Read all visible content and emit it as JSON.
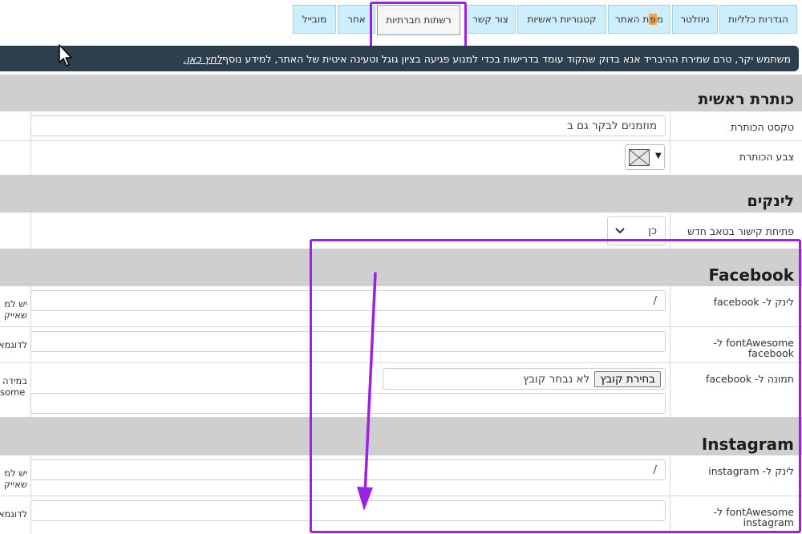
{
  "tabs": [
    {
      "label": "הגדרות כלליות"
    },
    {
      "label": "ניוזלטר"
    },
    {
      "label_prefix": "מ",
      "label_highlight": "פ",
      "label_suffix": "ת האתר"
    },
    {
      "label": "קטגוריות ראשיות"
    },
    {
      "label": "צור קשר"
    },
    {
      "label": "רשתות חברתיות"
    },
    {
      "label": "אחר"
    },
    {
      "label": "מובייל"
    }
  ],
  "notice": {
    "text": "משתמש יקר, טרם שמירת ההיבריד אנא בדוק שהקוד עומד בדרישות בכדי למנוע פגיעה בציון גוגל וטעינה איטית של האתר, למידע נוסף ",
    "link": "לחץ כאן."
  },
  "sections": {
    "main_title": "כותרת ראשית",
    "links": "לינקים",
    "facebook": "Facebook",
    "instagram": "Instagram"
  },
  "rows": {
    "title_text_label": "טקסט הכותרת",
    "title_text_value": "מוזמנים לבקר גם ב",
    "title_color_label": "צבע הכותרת",
    "new_tab_label": "פתיחת קישור בטאב חדש",
    "new_tab_value": "כן",
    "fb_link_label": "לינק ל- facebook",
    "fb_link_value": "/",
    "fb_fa_label_1": "fontAwesome ל-",
    "fb_fa_label_2": "facebook",
    "fb_img_label": "תמונה ל- facebook",
    "file_button": "בחירת קובץ",
    "file_none": "לא נבחר קובץ",
    "ig_link_label": "לינק ל- instagram",
    "ig_link_value": "/",
    "ig_fa_label_1": "fontAwesome ל-",
    "ig_fa_label_2": "instagram"
  },
  "cut_texts": {
    "fb_link_a": "יש למ",
    "fb_link_b": "שאייק",
    "fb_fa": "לדוגמא",
    "fb_img_a": "במידה",
    "fb_img_b": "some",
    "ig_link_a": "יש למ",
    "ig_link_b": "שאייק",
    "ig_fa": "לדוגמא"
  },
  "colors": {
    "accent_annotation": "#9b22e0",
    "tab_bg": "#cdeefc",
    "notice_bg": "#2d3e4c",
    "section_bg": "#cfcfcf"
  }
}
